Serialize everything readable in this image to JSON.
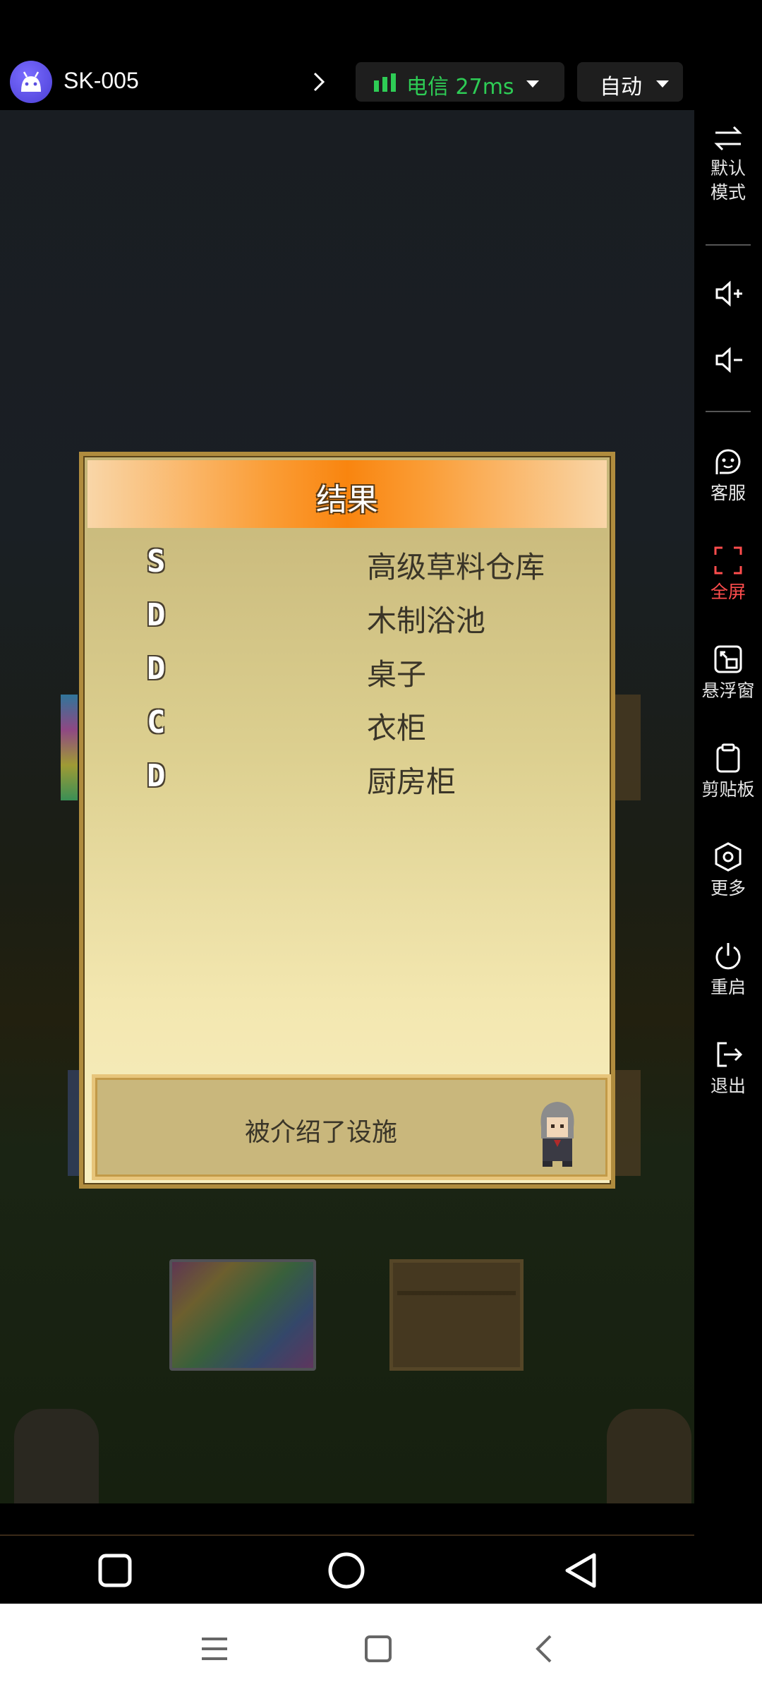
{
  "header": {
    "device_name": "SK-005",
    "network_label": "电信 27ms",
    "mode_label": "自动",
    "accent_green": "#2ecc55"
  },
  "side_panel": {
    "items": [
      {
        "icon": "swap-arrows-icon",
        "label": "默认\n模式"
      },
      {
        "icon": "volume-up-icon",
        "label": ""
      },
      {
        "icon": "volume-down-icon",
        "label": ""
      },
      {
        "icon": "customer-service-icon",
        "label": "客服"
      },
      {
        "icon": "fullscreen-icon",
        "label": "全屏",
        "color": "#ff4d4d"
      },
      {
        "icon": "floating-window-icon",
        "label": "悬浮窗"
      },
      {
        "icon": "clipboard-icon",
        "label": "剪贴板"
      },
      {
        "icon": "hexagon-settings-icon",
        "label": "更多"
      },
      {
        "icon": "power-icon",
        "label": "重启"
      },
      {
        "icon": "exit-icon",
        "label": "退出"
      }
    ]
  },
  "dialog": {
    "title": "结果",
    "results": [
      {
        "grade": "S",
        "facility": "高级草料仓库"
      },
      {
        "grade": "D",
        "facility": "木制浴池"
      },
      {
        "grade": "D",
        "facility": "桌子"
      },
      {
        "grade": "C",
        "facility": "衣柜"
      },
      {
        "grade": "D",
        "facility": "厨房柜"
      }
    ],
    "message": "被介绍了设施"
  },
  "nav": {
    "game_buttons": [
      "square-icon",
      "circle-icon",
      "triangle-back-icon"
    ],
    "system_buttons": [
      "menu-lines-icon",
      "home-square-icon",
      "back-chevron-icon"
    ]
  }
}
